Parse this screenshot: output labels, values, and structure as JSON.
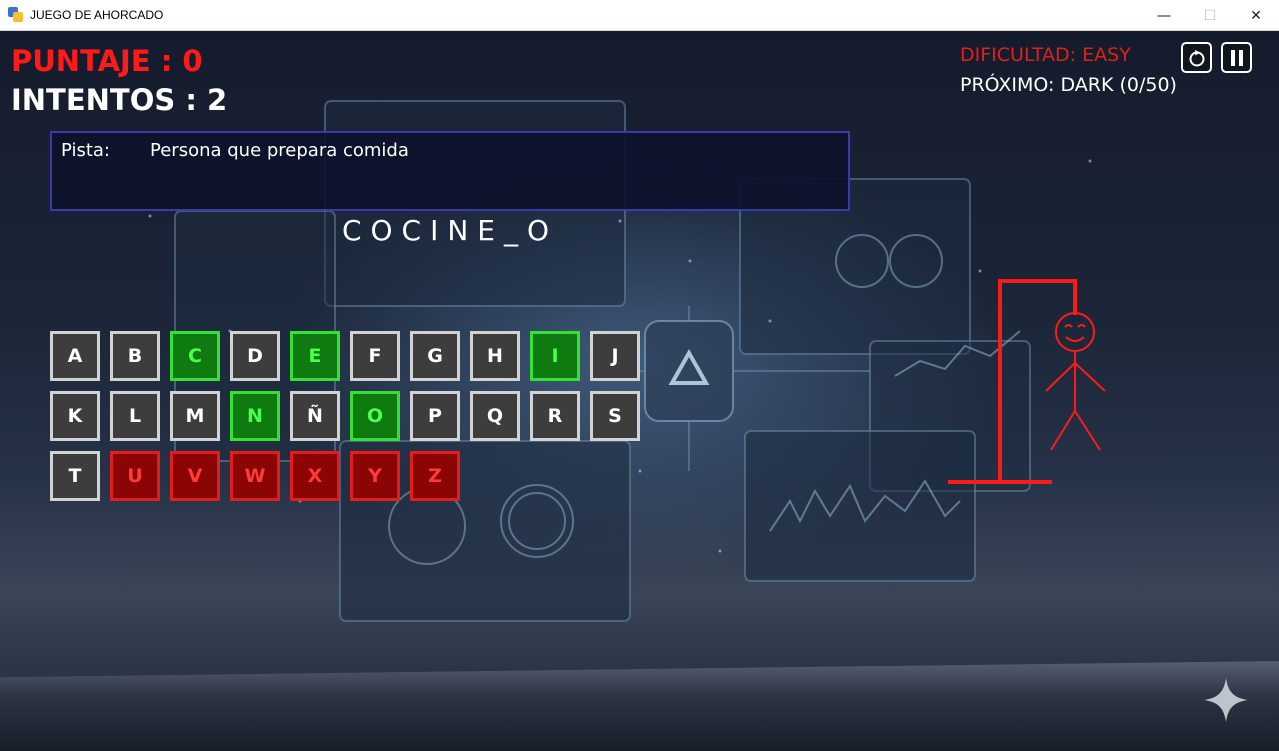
{
  "window": {
    "title": "JUEGO DE AHORCADO",
    "controls": {
      "minimize": "—",
      "maximize": "☐",
      "close": "✕"
    }
  },
  "hud": {
    "score": "PUNTAJE : 0",
    "attempts": "INTENTOS : 2",
    "difficulty": "DIFICULTAD: EASY",
    "next_level": "PRÓXIMO: DARK (0/50)",
    "buttons": {
      "restart": "restart-icon",
      "pause": "pause-icon"
    }
  },
  "hint": {
    "label": "Pista:",
    "text": "Persona que prepara comida"
  },
  "word": {
    "display": "COCINE_O"
  },
  "keyboard": {
    "rows": [
      [
        {
          "letter": "A",
          "state": "unused"
        },
        {
          "letter": "B",
          "state": "unused"
        },
        {
          "letter": "C",
          "state": "correct"
        },
        {
          "letter": "D",
          "state": "unused"
        },
        {
          "letter": "E",
          "state": "correct"
        },
        {
          "letter": "F",
          "state": "unused"
        },
        {
          "letter": "G",
          "state": "unused"
        },
        {
          "letter": "H",
          "state": "unused"
        },
        {
          "letter": "I",
          "state": "correct"
        },
        {
          "letter": "J",
          "state": "unused"
        }
      ],
      [
        {
          "letter": "K",
          "state": "unused"
        },
        {
          "letter": "L",
          "state": "unused"
        },
        {
          "letter": "M",
          "state": "unused"
        },
        {
          "letter": "N",
          "state": "correct"
        },
        {
          "letter": "Ñ",
          "state": "unused"
        },
        {
          "letter": "O",
          "state": "correct"
        },
        {
          "letter": "P",
          "state": "unused"
        },
        {
          "letter": "Q",
          "state": "unused"
        },
        {
          "letter": "R",
          "state": "unused"
        },
        {
          "letter": "S",
          "state": "unused"
        }
      ],
      [
        {
          "letter": "T",
          "state": "unused"
        },
        {
          "letter": "U",
          "state": "wrong"
        },
        {
          "letter": "V",
          "state": "wrong"
        },
        {
          "letter": "W",
          "state": "wrong"
        },
        {
          "letter": "X",
          "state": "wrong"
        },
        {
          "letter": "Y",
          "state": "wrong"
        },
        {
          "letter": "Z",
          "state": "wrong"
        }
      ]
    ]
  },
  "colors": {
    "score": "#ff1a1a",
    "difficulty": "#e0201a",
    "hangman": "#ff1a1a",
    "correct": "#0f7a10",
    "wrong": "#8c0505",
    "unused": "#3d3d3d"
  }
}
